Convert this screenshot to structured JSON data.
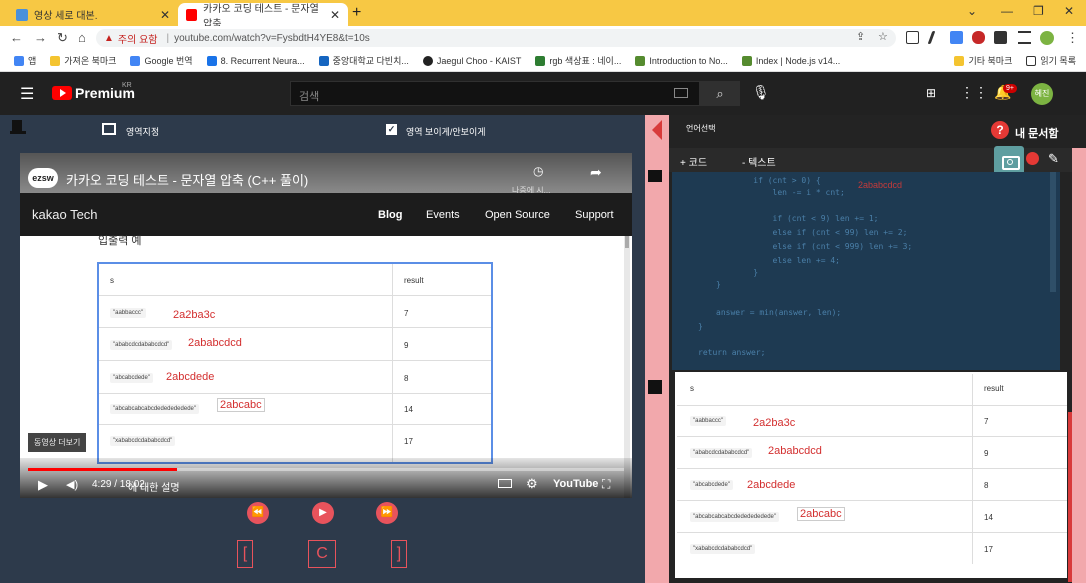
{
  "browser": {
    "tabs": [
      {
        "title": "영상 세로 대본."
      },
      {
        "title": "카카오 코딩 테스트 - 문자열 압축"
      }
    ],
    "new_tab": "+",
    "address": {
      "warning": "주의 요함",
      "url": "youtube.com/watch?v=FysbdtH4YE8&t=10s"
    },
    "bookmarks": [
      "앱",
      "가져온 북마크",
      "Google 번역",
      "8. Recurrent Neura...",
      "중앙대학교 다빈치...",
      "Jaegul Choo - KAIST",
      "rgb 색상표 : 네이...",
      "Introduction to No...",
      "Index | Node.js v14...",
      "기타 북마크",
      "읽기 목록"
    ]
  },
  "youtube": {
    "brand": "Premium",
    "region": "KR",
    "search_placeholder": "검색",
    "notification_count": "9+",
    "avatar_text": "혜진"
  },
  "player_panel": {
    "area_label": "영역지정",
    "toggle_label": "영역 보이게/안보이게",
    "toggle_checked": true,
    "video": {
      "channel_badge": "ezsw",
      "title": "카카오 코딩 테스트 - 문자열 압축 (C++ 풀이)",
      "watch_later": "나중에 시...",
      "site_name": "kakao Tech",
      "nav": [
        "Blog",
        "Events",
        "Open Source",
        "Support"
      ],
      "section_title": "입출력 예",
      "table_headers": [
        "s",
        "result"
      ],
      "rows": [
        {
          "s": "\"aabbaccc\"",
          "note": "2a2ba3c",
          "result": "7"
        },
        {
          "s": "\"ababcdcdababcdcd\"",
          "note": "2ababcdcd",
          "result": "9"
        },
        {
          "s": "\"abcabcdede\"",
          "note": "2abcdede",
          "result": "8"
        },
        {
          "s": "\"abcabcabcabcdededededede\"",
          "note": "2abcabc",
          "result": "14"
        },
        {
          "s": "\"xababcdcdababcdcd\"",
          "note": "",
          "result": "17"
        }
      ],
      "more_videos": "동영상 더보기",
      "time": "4:29 / 18:02",
      "chapter": "에 대한 설명",
      "watermark": "YouTube",
      "progress_percent": 25
    },
    "controls": {
      "rewind": "⏪",
      "play": "▶",
      "forward": "⏩",
      "bracket_open": "[",
      "center": "C",
      "bracket_close": "]"
    }
  },
  "editor_panel": {
    "language_label": "언어선택",
    "my_docs": "내 문서함",
    "add_code": "+ 코드",
    "remove_text": "- 텍스트",
    "code_lines": [
      "    if (cnt > 0) {",
      "        len -= i * cnt;",
      "",
      "        if (cnt < 9) len += 1;",
      "        else if (cnt < 99) len += 2;",
      "        else if (cnt < 999) len += 3;",
      "        else len += 4;",
      "    }",
      "}",
      "",
      "answer = min(answer, len);",
      "}",
      "",
      "return answer;"
    ],
    "code_annotation": "2ababcdcd",
    "doc_table": {
      "headers": [
        "s",
        "result"
      ],
      "rows": [
        {
          "s": "\"aabbaccc\"",
          "note": "2a2ba3c",
          "result": "7"
        },
        {
          "s": "\"ababcdcdababcdcd\"",
          "note": "2ababcdcd",
          "result": "9"
        },
        {
          "s": "\"abcabcdede\"",
          "note": "2abcdede",
          "result": "8"
        },
        {
          "s": "\"abcabcabcabcdededededede\"",
          "note": "2abcabc",
          "result": "14"
        },
        {
          "s": "\"xababcdcdababcdcd\"",
          "note": "",
          "result": "17"
        }
      ]
    }
  },
  "colors": {
    "accent": "#e8535c",
    "panel": "#2d3a4b",
    "annotation": "#d32f2f"
  }
}
